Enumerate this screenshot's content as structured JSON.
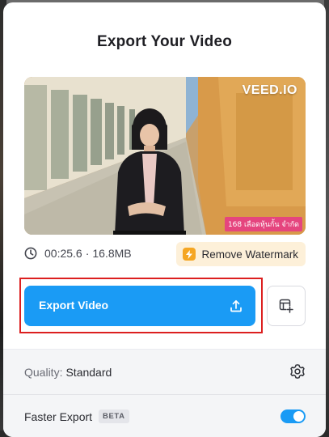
{
  "modal": {
    "title": "Export Your Video"
  },
  "preview": {
    "watermark": "VEED.IO",
    "caption": "168 เลือดหุ้นกั้น จำกัด"
  },
  "meta": {
    "duration": "00:25.6",
    "separator": "·",
    "size": "16.8MB",
    "remove_watermark_label": "Remove Watermark"
  },
  "actions": {
    "export_label": "Export Video"
  },
  "settings": {
    "quality_key": "Quality:",
    "quality_value": "Standard",
    "faster_export_label": "Faster Export",
    "faster_export_badge": "BETA",
    "faster_export_enabled": true
  },
  "icons": {
    "clock": "clock-icon",
    "bolt": "lightning-bolt-icon",
    "upload": "upload-icon",
    "add_template": "add-to-template-icon",
    "gear": "gear-icon"
  },
  "colors": {
    "primary": "#1a9bf5",
    "watermark_bg": "#fdf0d9",
    "bolt": "#f5a623",
    "highlight": "#dc1f1f"
  }
}
